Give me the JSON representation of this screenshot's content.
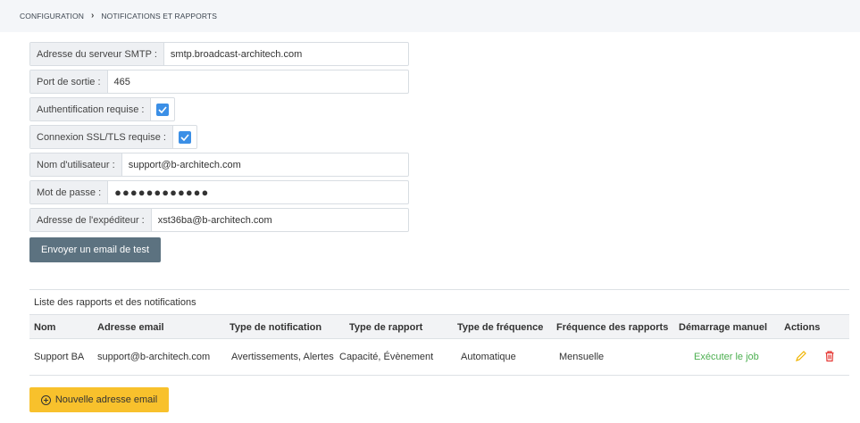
{
  "breadcrumb": {
    "root": "CONFIGURATION",
    "separator": "›",
    "current": "NOTIFICATIONS ET RAPPORTS"
  },
  "smtp": {
    "server_label": "Adresse du serveur SMTP :",
    "server_value": "smtp.broadcast-architech.com",
    "port_label": "Port de sortie :",
    "port_value": "465",
    "auth_label": "Authentification requise :",
    "auth_checked": true,
    "ssl_label": "Connexion SSL/TLS requise :",
    "ssl_checked": true,
    "user_label": "Nom d'utilisateur :",
    "user_value": "support@b-architech.com",
    "password_label": "Mot de passe :",
    "password_value": "●●●●●●●●●●●●",
    "sender_label": "Adresse de l'expéditeur :",
    "sender_value": "xst36ba@b-architech.com",
    "test_button": "Envoyer un email de test"
  },
  "reports": {
    "title": "Liste des rapports et des notifications",
    "columns": [
      "Nom",
      "Adresse email",
      "Type de notification",
      "Type de rapport",
      "Type de fréquence",
      "Fréquence des rapports",
      "Démarrage manuel",
      "Actions"
    ],
    "rows": [
      {
        "name": "Support BA",
        "email": "support@b-architech.com",
        "notification_type": "Avertissements, Alertes",
        "report_type": "Capacité, Évènement",
        "frequency_type": "Automatique",
        "report_frequency": "Mensuelle",
        "manual_start": "Exécuter le job",
        "actions": [
          "edit-icon",
          "delete-icon"
        ]
      }
    ],
    "new_button": "Nouvelle adresse email"
  },
  "colors": {
    "test_button_bg": "#5c7280",
    "new_button_bg": "#f8c12c",
    "checkbox": "#3b8fe6",
    "run_link": "#4caf50",
    "edit_icon": "#f0b400",
    "delete_icon": "#e53935"
  }
}
